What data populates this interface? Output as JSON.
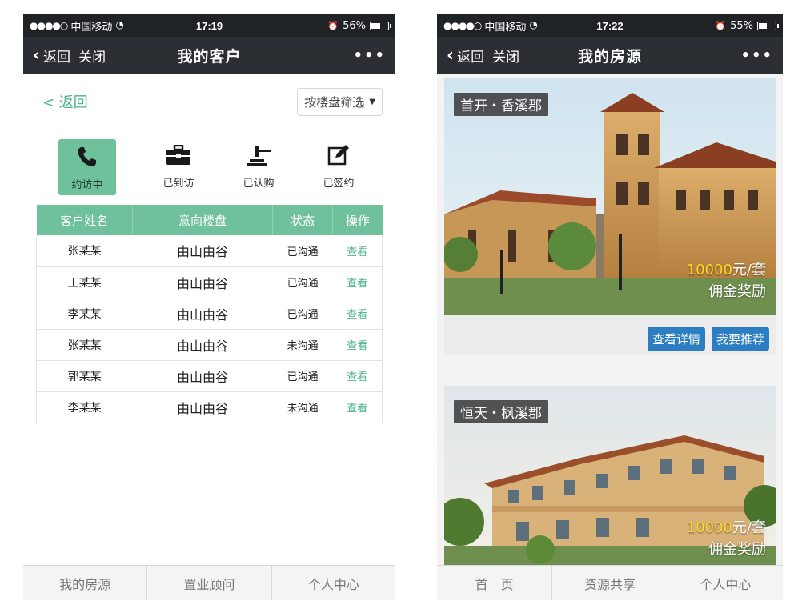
{
  "left": {
    "status": {
      "carrier": "中国移动",
      "signal_dots": "●●●●○",
      "time": "17:19",
      "battery": "56%",
      "battery_level": 0.56
    },
    "nav": {
      "back": "返回",
      "close": "关闭",
      "title": "我的客户",
      "more": "•••"
    },
    "back_link": "< 返回",
    "filter": {
      "label": "按楼盘筛选"
    },
    "tabs": [
      {
        "label": "约访中",
        "icon": "phone-icon",
        "active": true
      },
      {
        "label": "已到访",
        "icon": "briefcase-icon",
        "active": false
      },
      {
        "label": "已认购",
        "icon": "gavel-icon",
        "active": false
      },
      {
        "label": "已签约",
        "icon": "edit-icon",
        "active": false
      }
    ],
    "table": {
      "headers": [
        "客户姓名",
        "意向楼盘",
        "状态",
        "操作"
      ],
      "rows": [
        [
          "张某某",
          "由山由谷",
          "已沟通",
          "查看"
        ],
        [
          "王某某",
          "由山由谷",
          "已沟通",
          "查看"
        ],
        [
          "李某某",
          "由山由谷",
          "已沟通",
          "查看"
        ],
        [
          "张某某",
          "由山由谷",
          "未沟通",
          "查看"
        ],
        [
          "郭某某",
          "由山由谷",
          "已沟通",
          "查看"
        ],
        [
          "李某某",
          "由山由谷",
          "未沟通",
          "查看"
        ]
      ]
    },
    "tabbar": [
      "我的房源",
      "置业顾问",
      "个人中心"
    ]
  },
  "right": {
    "status": {
      "carrier": "中国移动",
      "signal_dots": "●●●●○",
      "time": "17:22",
      "battery": "55%",
      "battery_level": 0.55
    },
    "nav": {
      "back": "返回",
      "close": "关闭",
      "title": "我的房源",
      "more": "•••"
    },
    "cards": [
      {
        "name": "首开・香溪郡",
        "amount": "10000",
        "unit": "元/套",
        "reward": "佣金奖励",
        "buttons": [
          "查看详情",
          "我要推荐"
        ]
      },
      {
        "name": "恒天・枫溪郡",
        "amount": "10000",
        "unit": "元/套",
        "reward": "佣金奖励"
      }
    ],
    "tabbar": [
      "首　页",
      "资源共享",
      "个人中心"
    ]
  },
  "colors": {
    "accent": "#6fc19c",
    "nav_bg": "#2b2f33",
    "button_blue": "#2c7ec2",
    "reward_yellow": "#ffd928"
  }
}
